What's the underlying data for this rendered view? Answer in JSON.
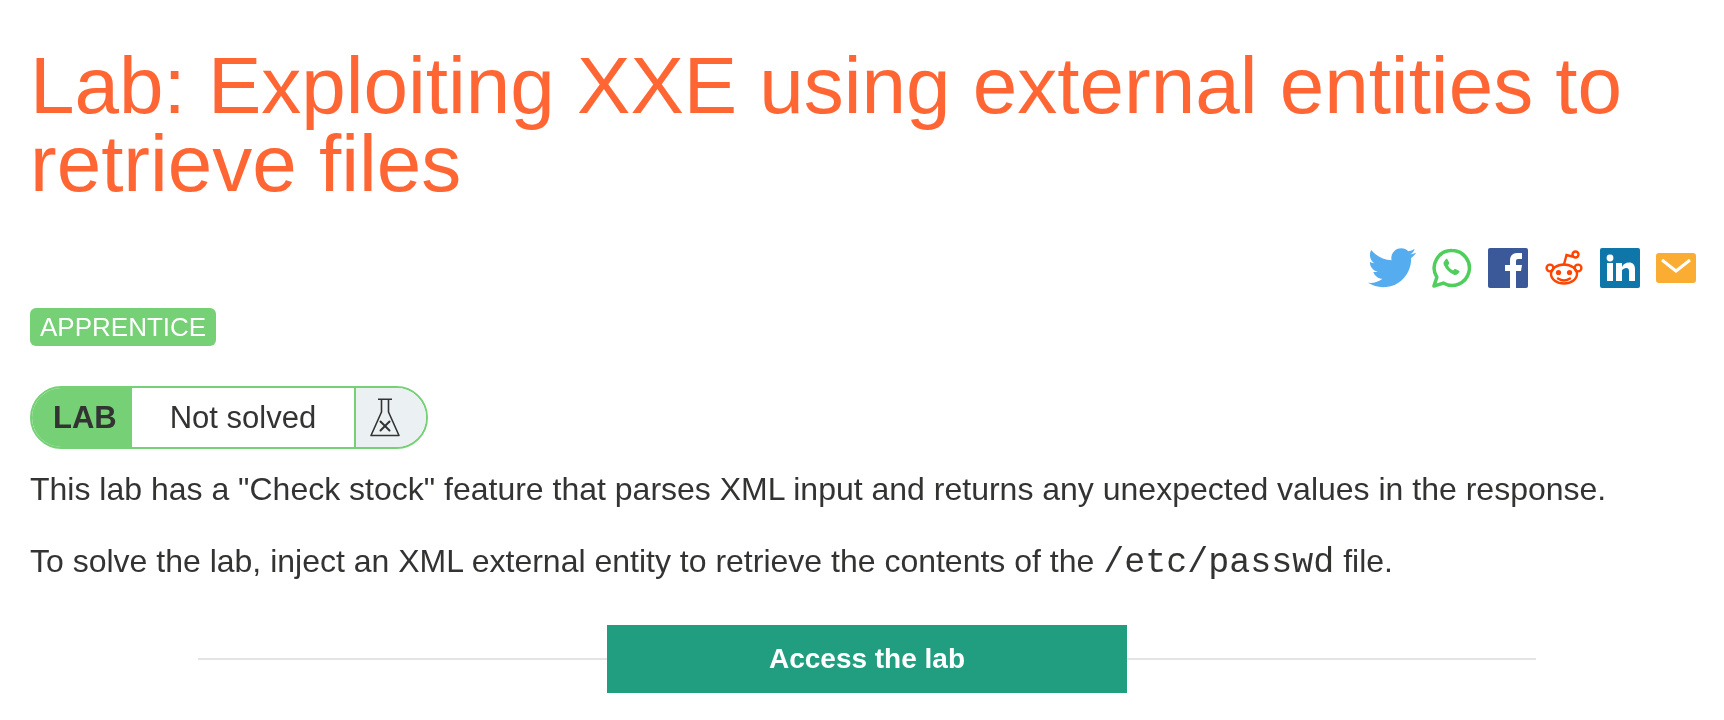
{
  "title": "Lab: Exploiting XXE using external entities to retrieve files",
  "level_badge": {
    "label": "APPRENTICE"
  },
  "lab_status": {
    "label": "LAB",
    "status": "Not solved",
    "solved": false
  },
  "description": [
    [
      {
        "kind": "text",
        "text": "This lab has a \"Check stock\" feature that parses XML input and returns any unexpected values in the response."
      }
    ],
    [
      {
        "kind": "text",
        "text": "To solve the lab, inject an XML external entity to retrieve the contents of the "
      },
      {
        "kind": "code",
        "text": "/etc/passwd"
      },
      {
        "kind": "text",
        "text": " file."
      }
    ]
  ],
  "access_button": {
    "label": "Access the lab"
  }
}
